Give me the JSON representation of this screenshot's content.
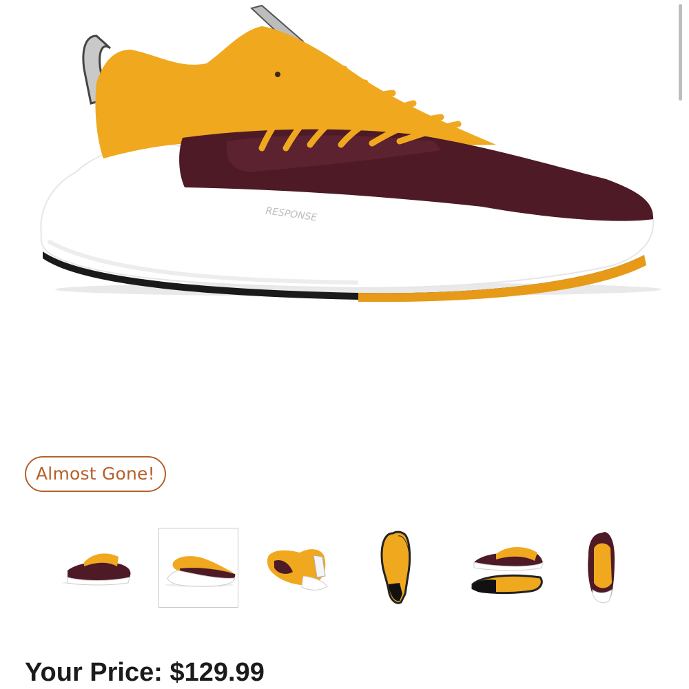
{
  "product": {
    "hero_image": "sneaker-side-view",
    "sole_text": "RESPONSE",
    "colors": {
      "gold": "#F0A81F",
      "maroon": "#4E1A26",
      "white": "#FFFFFF"
    }
  },
  "badge": {
    "label": "Almost Gone!",
    "color": "#B5602B"
  },
  "thumbnails": [
    {
      "view": "side-angle",
      "selected": false
    },
    {
      "view": "side",
      "selected": true
    },
    {
      "view": "heel-angle",
      "selected": false
    },
    {
      "view": "outsole-pair",
      "selected": false
    },
    {
      "view": "top-and-bottom",
      "selected": false
    },
    {
      "view": "front",
      "selected": false
    }
  ],
  "price": {
    "label": "Your Price: $129.99"
  }
}
